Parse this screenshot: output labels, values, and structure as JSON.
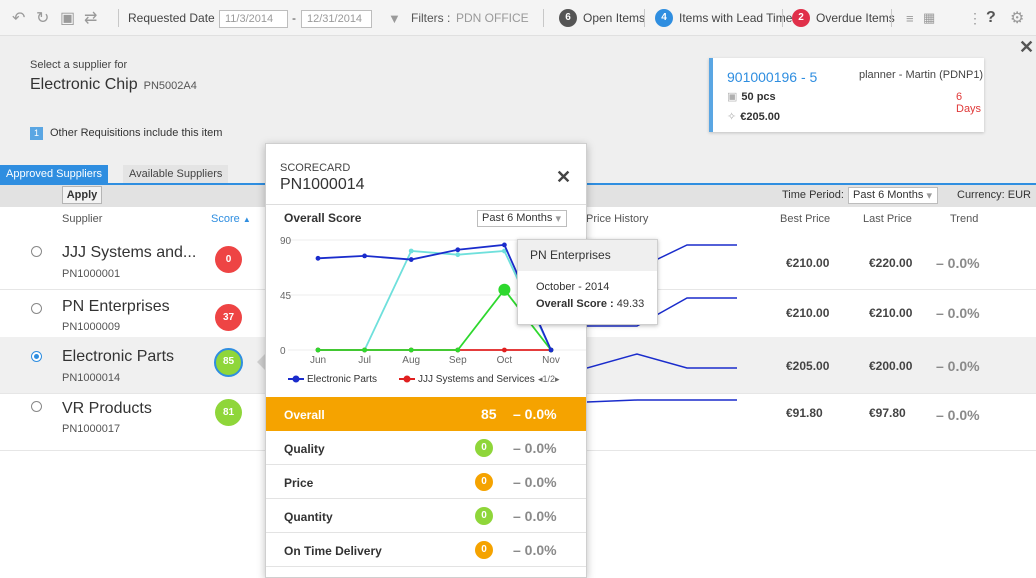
{
  "toolbar": {
    "requested_date_label": "Requested Date :",
    "date_from": "11/3/2014",
    "date_dash": "-",
    "date_to": "12/31/2014",
    "filters_label": "Filters :",
    "filters_value": "PDN OFFICE",
    "open_items": {
      "count": "6",
      "label": "Open Items",
      "color": "#555555"
    },
    "lead_time_items": {
      "count": "4",
      "label": "Items with Lead Time",
      "color": "#2f8ee0"
    },
    "overdue_items": {
      "count": "2",
      "label": "Overdue Items",
      "color": "#e0304a"
    },
    "help": "?"
  },
  "header": {
    "select_supplier_label": "Select a supplier for",
    "product_name": "Electronic Chip",
    "product_code": "PN5002A4",
    "other_req_count": "1",
    "other_req_text": "Other Requisitions include this item"
  },
  "requisition_card": {
    "id": "901000196 - 5",
    "planner": "planner - Martin (PDNP1)",
    "days": "6 Days",
    "qty": "50 pcs",
    "price": "€205.00"
  },
  "tabs": [
    {
      "label": "Approved Suppliers",
      "active": true
    },
    {
      "label": "Available Suppliers",
      "active": false
    }
  ],
  "filter_bar": {
    "apply": "Apply",
    "time_period_label": "Time Period:",
    "time_period_value": "Past 6 Months",
    "currency": "Currency:  EUR"
  },
  "columns": {
    "supplier": "Supplier",
    "score": "Score",
    "price_history": "Price History",
    "best_price": "Best Price",
    "last_price": "Last Price",
    "trend": "Trend"
  },
  "suppliers": [
    {
      "name": "JJJ Systems and...",
      "code": "PN1000001",
      "score": "0",
      "score_color": "#ee4444",
      "best": "€210.00",
      "last": "€220.00",
      "trend": "– 0.0%",
      "selected": false
    },
    {
      "name": "PN Enterprises",
      "code": "PN1000009",
      "score": "37",
      "score_color": "#ee4444",
      "best": "€210.00",
      "last": "€210.00",
      "trend": "– 0.0%",
      "selected": false
    },
    {
      "name": "Electronic Parts",
      "code": "PN1000014",
      "score": "85",
      "score_color": "#8fd63a",
      "best": "€205.00",
      "last": "€200.00",
      "trend": "– 0.0%",
      "selected": true
    },
    {
      "name": "VR Products",
      "code": "PN1000017",
      "score": "81",
      "score_color": "#8fd63a",
      "best": "€91.80",
      "last": "€97.80",
      "trend": "– 0.0%",
      "selected": false
    }
  ],
  "scorecard": {
    "label": "SCORECARD",
    "id": "PN1000014",
    "overall_score_label": "Overall Score",
    "period": "Past 6 Months",
    "legend_page": "1/2",
    "rows": [
      {
        "label": "Overall",
        "value": "85",
        "trend": "– 0.0%",
        "color": "#f5a300"
      },
      {
        "label": "Quality",
        "value": "0",
        "trend": "– 0.0%",
        "color": "#8fd63a"
      },
      {
        "label": "Price",
        "value": "0",
        "trend": "– 0.0%",
        "color": "#f5a300"
      },
      {
        "label": "Quantity",
        "value": "0",
        "trend": "– 0.0%",
        "color": "#8fd63a"
      },
      {
        "label": "On Time Delivery",
        "value": "0",
        "trend": "– 0.0%",
        "color": "#f5a300"
      }
    ]
  },
  "tooltip": {
    "supplier": "PN Enterprises",
    "date": "October - 2014",
    "score_label": "Overall Score :",
    "score_value": "49.33"
  },
  "chart_data": {
    "type": "line",
    "categories": [
      "Jun",
      "Jul",
      "Aug",
      "Sep",
      "Oct",
      "Nov"
    ],
    "ylim": [
      0,
      90
    ],
    "yticks": [
      "0",
      "45",
      "90"
    ],
    "series": [
      {
        "name": "Electronic Parts",
        "color": "#1a2ccc",
        "values": [
          75,
          77,
          74,
          82,
          86,
          0
        ]
      },
      {
        "name": "JJJ Systems and Services",
        "color": "#e02020",
        "values": [
          0,
          0,
          0,
          0,
          0,
          0
        ]
      },
      {
        "color": "#6fe0dc",
        "values": [
          0,
          0,
          81,
          78,
          81,
          0
        ]
      },
      {
        "color": "#2ed82e",
        "values": [
          0,
          0,
          0,
          0,
          49.33,
          0
        ]
      }
    ]
  },
  "price_history": [
    [
      0,
      8,
      8
    ],
    [
      5,
      0,
      0
    ],
    [
      10,
      0,
      6
    ],
    [
      3,
      0,
      0
    ]
  ]
}
